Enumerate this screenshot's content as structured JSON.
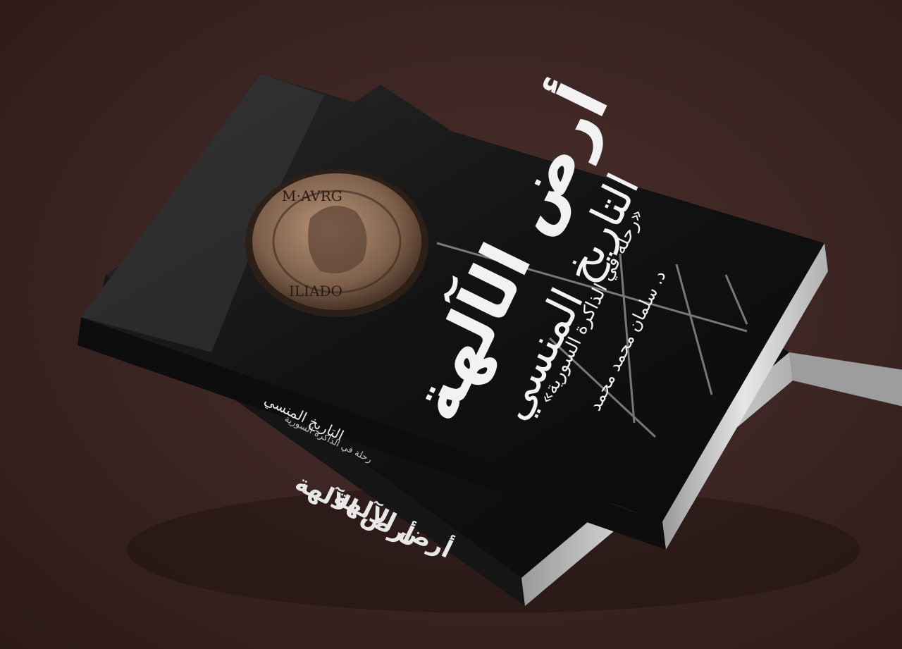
{
  "book": {
    "title": "أرض الآلهة",
    "subtitle": "التاريخ المنسي",
    "tagline": "«رحلة في الذاكرة السورية»",
    "author": "د. سلمان محمد محمد",
    "coin_legend_top": "M·AVRG",
    "coin_legend_bottom": "ILIADO"
  },
  "spine_top": {
    "title": "أرض الآلهة",
    "subtitle": "التاريخ المنسي",
    "tagline": "رحلة في الذاكرة السورية"
  },
  "spine_bottom": {
    "title": "أرض الآلهة"
  },
  "colors": {
    "background": "#3d2623",
    "cover": "#111111",
    "pages": "#d8d8d8",
    "coin": "#8a6a52"
  }
}
